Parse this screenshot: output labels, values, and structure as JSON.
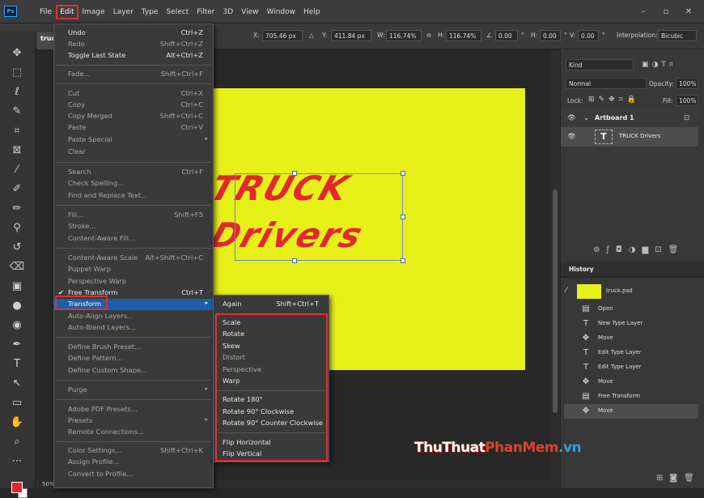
{
  "app": {
    "logo": "Ps"
  },
  "menubar": {
    "items": [
      "File",
      "Edit",
      "Image",
      "Layer",
      "Type",
      "Select",
      "Filter",
      "3D",
      "View",
      "Window",
      "Help"
    ],
    "window_controls": [
      "–",
      "▫",
      "✕"
    ]
  },
  "options_bar": {
    "x_label": "X:",
    "x_value": "705.46 px",
    "y_label": "Y:",
    "y_value": "411.84 px",
    "w_label": "W:",
    "w_value": "116.74%",
    "h_label": "H:",
    "h_value": "116.74%",
    "angle_value": "0.00",
    "deg1": "°",
    "hskew_label": "H:",
    "hskew_value": "0.00",
    "deg2": "°",
    "vskew_label": "V:",
    "vskew_value": "0.00",
    "deg3": "°",
    "interp_label": "Interpolation:",
    "interp_value": "Bicubic"
  },
  "doc_tab": {
    "name": "truc"
  },
  "canvas": {
    "line1": "TRUCK",
    "line2": "Drivers",
    "artboard_color": "#e8f01a",
    "text_color": "#e3282d",
    "zoom": "50%"
  },
  "edit_menu": {
    "items": [
      {
        "label": "Undo",
        "shortcut": "Ctrl+Z",
        "enabled": true
      },
      {
        "label": "Redo",
        "shortcut": "Shift+Ctrl+Z",
        "enabled": false
      },
      {
        "label": "Toggle Last State",
        "shortcut": "Alt+Ctrl+Z",
        "enabled": true
      },
      {
        "label": "Fade...",
        "shortcut": "Shift+Ctrl+F",
        "enabled": false
      },
      {
        "label": "Cut",
        "shortcut": "Ctrl+X",
        "enabled": false
      },
      {
        "label": "Copy",
        "shortcut": "Ctrl+C",
        "enabled": false
      },
      {
        "label": "Copy Merged",
        "shortcut": "Shift+Ctrl+C",
        "enabled": false
      },
      {
        "label": "Paste",
        "shortcut": "Ctrl+V",
        "enabled": false
      },
      {
        "label": "Paste Special",
        "shortcut": "",
        "enabled": false
      },
      {
        "label": "Clear",
        "shortcut": "",
        "enabled": false
      },
      {
        "label": "Search",
        "shortcut": "Ctrl+F",
        "enabled": false
      },
      {
        "label": "Check Spelling...",
        "shortcut": "",
        "enabled": false
      },
      {
        "label": "Find and Replace Text...",
        "shortcut": "",
        "enabled": false
      },
      {
        "label": "Fill...",
        "shortcut": "Shift+F5",
        "enabled": false
      },
      {
        "label": "Stroke...",
        "shortcut": "",
        "enabled": false
      },
      {
        "label": "Content-Aware Fill...",
        "shortcut": "",
        "enabled": false
      },
      {
        "label": "Content-Aware Scale",
        "shortcut": "Alt+Shift+Ctrl+C",
        "enabled": false
      },
      {
        "label": "Puppet Warp",
        "shortcut": "",
        "enabled": false
      },
      {
        "label": "Perspective Warp",
        "shortcut": "",
        "enabled": false
      },
      {
        "label": "Free Transform",
        "shortcut": "Ctrl+T",
        "enabled": true
      },
      {
        "label": "Transform",
        "shortcut": "",
        "enabled": true
      },
      {
        "label": "Auto-Align Layers...",
        "shortcut": "",
        "enabled": false
      },
      {
        "label": "Auto-Blend Layers...",
        "shortcut": "",
        "enabled": false
      },
      {
        "label": "Define Brush Preset...",
        "shortcut": "",
        "enabled": false
      },
      {
        "label": "Define Pattern...",
        "shortcut": "",
        "enabled": false
      },
      {
        "label": "Define Custom Shape...",
        "shortcut": "",
        "enabled": false
      },
      {
        "label": "Purge",
        "shortcut": "",
        "enabled": false
      },
      {
        "label": "Adobe PDF Presets...",
        "shortcut": "",
        "enabled": false
      },
      {
        "label": "Presets",
        "shortcut": "",
        "enabled": false
      },
      {
        "label": "Remote Connections...",
        "shortcut": "",
        "enabled": false
      },
      {
        "label": "Color Settings...",
        "shortcut": "Shift+Ctrl+K",
        "enabled": false
      },
      {
        "label": "Assign Profile...",
        "shortcut": "",
        "enabled": false
      },
      {
        "label": "Convert to Profile...",
        "shortcut": "",
        "enabled": false
      }
    ],
    "checkmark": "✔"
  },
  "transform_submenu": {
    "items": [
      {
        "label": "Again",
        "shortcut": "Shift+Ctrl+T",
        "enabled": true
      },
      {
        "label": "Scale",
        "shortcut": "",
        "enabled": true
      },
      {
        "label": "Rotate",
        "shortcut": "",
        "enabled": true
      },
      {
        "label": "Skew",
        "shortcut": "",
        "enabled": true
      },
      {
        "label": "Distort",
        "shortcut": "",
        "enabled": false
      },
      {
        "label": "Perspective",
        "shortcut": "",
        "enabled": false
      },
      {
        "label": "Warp",
        "shortcut": "",
        "enabled": true
      },
      {
        "label": "Rotate 180°",
        "shortcut": "",
        "enabled": true
      },
      {
        "label": "Rotate 90° Clockwise",
        "shortcut": "",
        "enabled": true
      },
      {
        "label": "Rotate 90° Counter Clockwise",
        "shortcut": "",
        "enabled": true
      },
      {
        "label": "Flip Horizontal",
        "shortcut": "",
        "enabled": true
      },
      {
        "label": "Flip Vertical",
        "shortcut": "",
        "enabled": true
      }
    ]
  },
  "layers_panel": {
    "search_placeholder": "Kind",
    "blend_mode": "Normal",
    "opacity_label": "Opacity:",
    "opacity_value": "100%",
    "lock_label": "Lock:",
    "fill_label": "Fill:",
    "fill_value": "100%",
    "artboard_name": "Artboard 1",
    "layer_name": "TRUCK Drivers",
    "layer_thumb": "T"
  },
  "history_panel": {
    "title": "History",
    "snapshot": "truck.psd",
    "items": [
      {
        "icon": "doc",
        "label": "Open"
      },
      {
        "icon": "T",
        "label": "New Type Layer"
      },
      {
        "icon": "move",
        "label": "Move"
      },
      {
        "icon": "T",
        "label": "Edit Type Layer"
      },
      {
        "icon": "T",
        "label": "Edit Type Layer"
      },
      {
        "icon": "move",
        "label": "Move"
      },
      {
        "icon": "doc",
        "label": "Free Transform"
      },
      {
        "icon": "move",
        "label": "Move"
      }
    ]
  },
  "watermark": {
    "part1": "ThuThuat",
    "part2": "PhanMem",
    "part3": ".vn"
  },
  "colors": {
    "highlight": "#1a5fa8",
    "callout_red": "#e03030",
    "foreground": "#e3282d",
    "background": "#ffffff"
  }
}
